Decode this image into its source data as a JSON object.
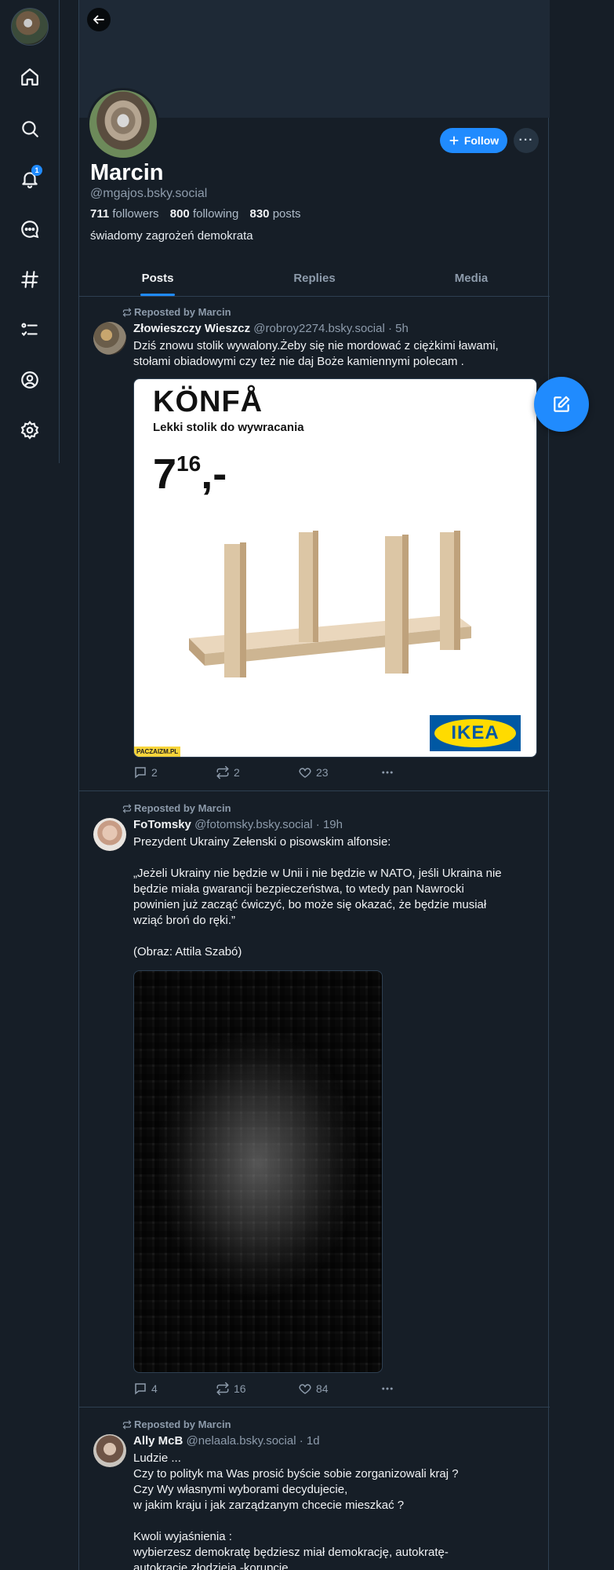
{
  "nav": {
    "badge_count": "1",
    "icons": [
      "home-icon",
      "search-icon",
      "bell-icon",
      "chat-icon",
      "hashtag-icon",
      "list-icon",
      "profile-icon",
      "gear-icon"
    ]
  },
  "profile": {
    "name": "Marcin",
    "handle": "@mgajos.bsky.social",
    "followers_count": "711",
    "followers_label": "followers",
    "following_count": "800",
    "following_label": "following",
    "posts_count": "830",
    "posts_label": "posts",
    "bio": "świadomy zagrożeń demokrata",
    "follow_label": "Follow",
    "more_label": "···"
  },
  "tabs": [
    {
      "label": "Posts",
      "active": true
    },
    {
      "label": "Replies",
      "active": false
    },
    {
      "label": "Media",
      "active": false
    }
  ],
  "posts": [
    {
      "repost_label": "Reposted by Marcin",
      "author": "Złowieszczy Wieszcz",
      "handle": "@robroy2274.bsky.social",
      "time": "· 5h",
      "lines": [
        "Dziś znowu stolik  wywalony.Żeby się nie mordować z ciężkimi  ławami,",
        "stołami obiadowymi czy też nie daj Boże kamiennymi polecam ."
      ],
      "image": {
        "brand": "KÖNFÅ",
        "desc": "Lekki stolik do wywracania",
        "price_main": "7",
        "price_cents": "16",
        "price_suffix": ",-",
        "logo": "IKEA",
        "watermark": "PACZAIZM.PL"
      },
      "replies": "2",
      "reposts": "2",
      "likes": "23"
    },
    {
      "repost_label": "Reposted by Marcin",
      "author": "FoTomsky",
      "handle": "@fotomsky.bsky.social",
      "time": "· 19h",
      "lines": [
        "Prezydent Ukrainy Zełenski o pisowskim alfonsie:",
        "",
        "„Jeżeli Ukrainy nie będzie w Unii i nie będzie w NATO, jeśli Ukraina nie",
        "będzie miała gwarancji bezpieczeństwa, to wtedy pan Nawrocki",
        "powinien już zacząć ćwiczyć, bo może się okazać, że będzie musiał",
        "wziąć broń do ręki.”",
        "",
        "(Obraz: Attila Szabó)"
      ],
      "replies": "4",
      "reposts": "16",
      "likes": "84"
    },
    {
      "repost_label": "Reposted by Marcin",
      "author": "Ally McB",
      "handle": "@nelaala.bsky.social",
      "time": "· 1d",
      "lines": [
        "Ludzie ...",
        "Czy to polityk ma Was prosić byście sobie zorganizowali kraj ?",
        "Czy Wy własnymi wyborami decydujecie,",
        "w jakim kraju i jak zarządzanym  chcecie mieszkać ?",
        "",
        "Kwoli wyjaśnienia :",
        "wybierzesz demokratę będziesz miał demokrację, autokratę-",
        "autokrację,złodzieja -korupcję."
      ]
    }
  ],
  "colors": {
    "background": "#161e27",
    "accent": "#208bfe",
    "border": "#2e4052",
    "muted_text": "#8d9bab"
  }
}
